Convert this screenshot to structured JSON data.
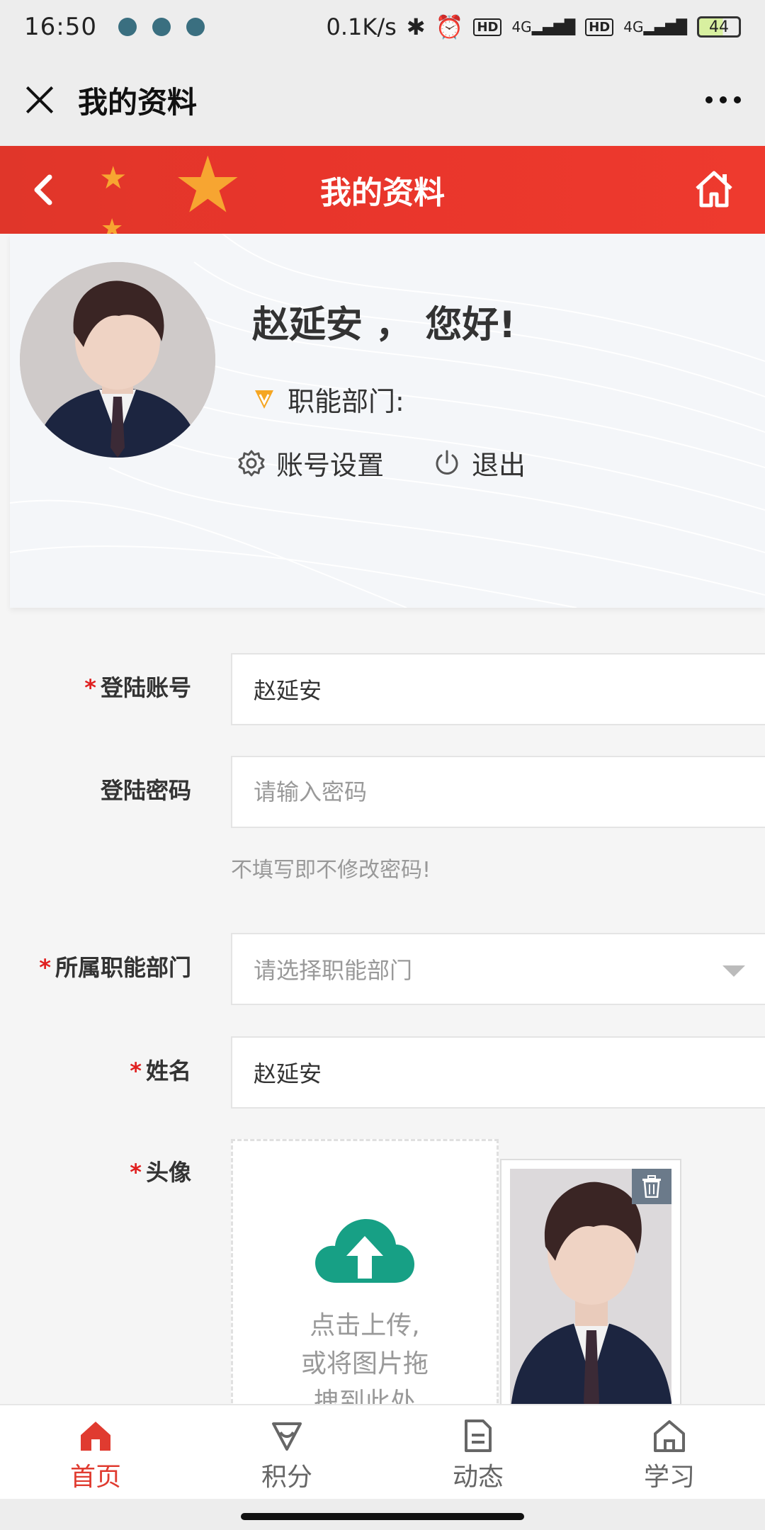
{
  "status_bar": {
    "time": "16:50",
    "network_speed": "0.1K/s",
    "sim1_label": "HD",
    "sim1_net": "4G",
    "sim2_label": "HD",
    "sim2_net": "4G",
    "battery": "44"
  },
  "wechat_bar": {
    "title": "我的资料"
  },
  "header": {
    "title": "我的资料"
  },
  "profile": {
    "greeting": "赵延安 ， 您好!",
    "department_label": "职能部门:",
    "account_settings": "账号设置",
    "logout": "退出"
  },
  "form": {
    "account": {
      "label": "登陆账号",
      "value": "赵延安"
    },
    "password": {
      "label": "登陆密码",
      "placeholder": "请输入密码",
      "hint": "不填写即不修改密码!"
    },
    "department": {
      "label": "所属职能部门",
      "placeholder": "请选择职能部门"
    },
    "name": {
      "label": "姓名",
      "value": "赵延安"
    },
    "avatar": {
      "label": "头像",
      "upload_text_1": "点击上传,",
      "upload_text_2": "或将图片拖",
      "upload_text_3": "拽到此处"
    },
    "required_mark": "*"
  },
  "tabs": [
    {
      "label": "首页",
      "icon": "home-icon",
      "active": true
    },
    {
      "label": "积分",
      "icon": "gem-icon",
      "active": false
    },
    {
      "label": "动态",
      "icon": "document-icon",
      "active": false
    },
    {
      "label": "学习",
      "icon": "house-outline-icon",
      "active": false
    }
  ],
  "colors": {
    "brand_red": "#e8352b",
    "upload_green": "#17a085",
    "accent_orange": "#f5a623"
  }
}
